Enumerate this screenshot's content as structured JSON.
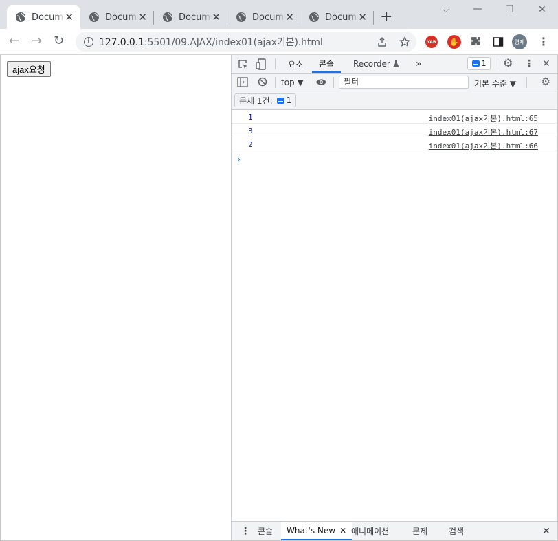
{
  "browser": {
    "tabs": [
      {
        "title": "Document",
        "close": "✕"
      },
      {
        "title": "Document",
        "close": "✕"
      },
      {
        "title": "Document",
        "close": "✕"
      },
      {
        "title": "Document",
        "close": "✕"
      },
      {
        "title": "Document",
        "close": "✕"
      }
    ],
    "new_tab": "+",
    "window_controls": {
      "dropdown": "⌵",
      "minimize": "—",
      "maximize": "☐",
      "close": "✕"
    },
    "nav": {
      "back": "←",
      "forward": "→",
      "reload": "↻"
    },
    "address": {
      "host": "127.0.0.1",
      "rest": ":5501/09.AJAX/index01(ajax기본).html"
    },
    "extensions": {
      "yab": "YAB",
      "red": "✋"
    },
    "avatar": "영제",
    "menu": "⋮"
  },
  "page": {
    "button_label": "ajax요청"
  },
  "devtools": {
    "tabs": {
      "elements": "요소",
      "console": "콘솔",
      "recorder": "Recorder",
      "more": "»"
    },
    "issue_count": "1",
    "settings": "⚙",
    "kebab": "⋮",
    "close": "✕",
    "toolbar": {
      "context": "top ▼",
      "filter_placeholder": "필터",
      "level": "기본 수준 ▼"
    },
    "issues_chip": {
      "label": "문제 1건:",
      "count": "1"
    },
    "logs": [
      {
        "value": "1",
        "source": "index01(ajax기본).html:65"
      },
      {
        "value": "3",
        "source": "index01(ajax기본).html:67"
      },
      {
        "value": "2",
        "source": "index01(ajax기본).html:66"
      }
    ],
    "prompt": "›",
    "drawer": {
      "menu": "⋮",
      "tabs": [
        "콘솔",
        "What's New",
        "애니메이션",
        "문제",
        "검색"
      ],
      "whats_new_close": "✕",
      "close": "✕"
    }
  }
}
